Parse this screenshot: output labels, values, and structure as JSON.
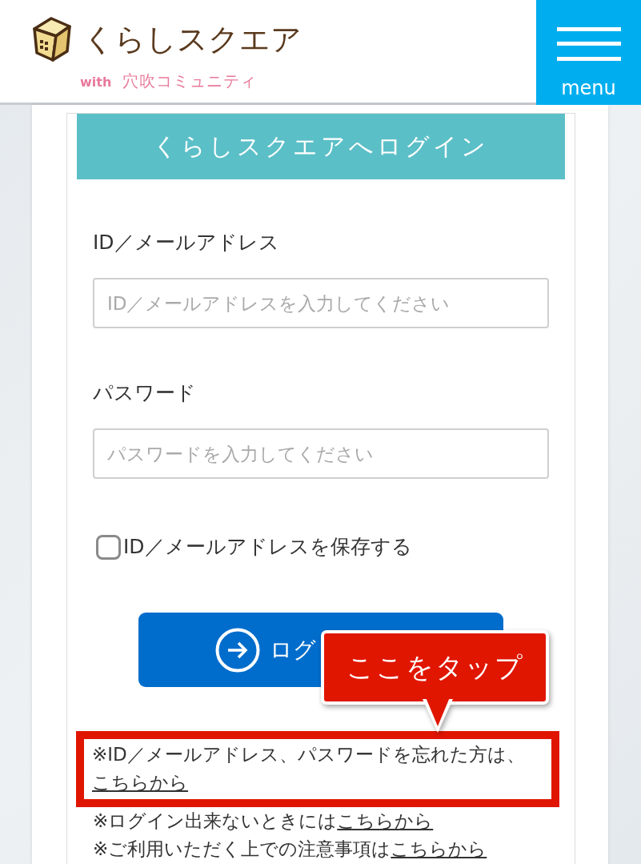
{
  "header": {
    "logo": {
      "title": "くらしスクエア",
      "prefix": "with",
      "subtitle": "穴吹コミュニティ"
    },
    "menu_button": {
      "label": "menu"
    }
  },
  "login_form": {
    "title": "くらしスクエアへログイン",
    "fields": [
      {
        "label": "ID／メールアドレス",
        "placeholder": "ID／メールアドレスを入力してください"
      },
      {
        "label": "パスワード",
        "placeholder": "パスワードを入力してください"
      }
    ],
    "remember": {
      "label": "ID／メールアドレスを保存する",
      "checked": false
    },
    "submit_button": {
      "label": "ログ"
    },
    "notes": [
      {
        "text": "※ID／メールアドレス、パスワードを忘れた方は、",
        "link": "こちらから",
        "highlighted": true
      },
      {
        "text": "※ログイン出来ないときには",
        "link": "こちらから",
        "highlighted": false
      },
      {
        "text": "※ご利用いただく上での注意事項は",
        "link": "こちらから",
        "highlighted": false
      }
    ]
  },
  "callout": {
    "text": "ここをタップ"
  }
}
